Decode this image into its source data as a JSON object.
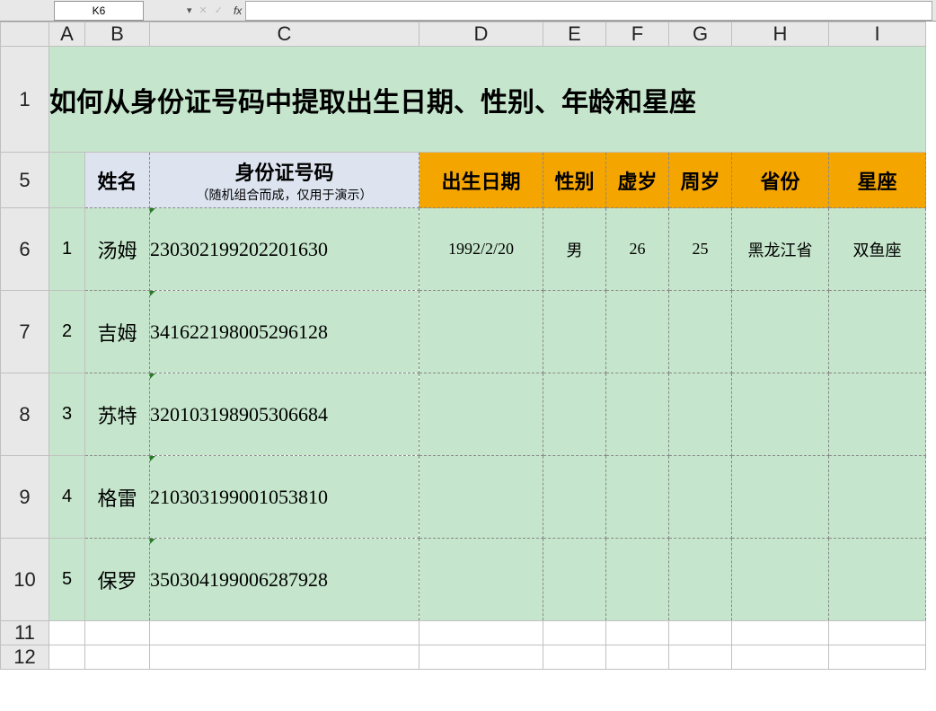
{
  "formula_bar": {
    "name_box": "K6",
    "fx_label": "fx"
  },
  "columns": [
    "A",
    "B",
    "C",
    "D",
    "E",
    "F",
    "G",
    "H",
    "I"
  ],
  "row_labels": [
    "1",
    "5",
    "6",
    "7",
    "8",
    "9",
    "10",
    "11",
    "12"
  ],
  "title": "如何从身份证号码中提取出生日期、性别、年龄和星座",
  "headers": {
    "name": "姓名",
    "id": "身份证号码",
    "id_sub": "（随机组合而成，仅用于演示）",
    "birth": "出生日期",
    "gender": "性别",
    "age_nominal": "虚岁",
    "age_full": "周岁",
    "province": "省份",
    "zodiac": "星座"
  },
  "rows": [
    {
      "idx": "1",
      "name": "汤姆",
      "id": "230302199202201630",
      "birth": "1992/2/20",
      "gender": "男",
      "age_nominal": "26",
      "age_full": "25",
      "province": "黑龙江省",
      "zodiac": "双鱼座"
    },
    {
      "idx": "2",
      "name": "吉姆",
      "id": "341622198005296128",
      "birth": "",
      "gender": "",
      "age_nominal": "",
      "age_full": "",
      "province": "",
      "zodiac": ""
    },
    {
      "idx": "3",
      "name": "苏特",
      "id": "320103198905306684",
      "birth": "",
      "gender": "",
      "age_nominal": "",
      "age_full": "",
      "province": "",
      "zodiac": ""
    },
    {
      "idx": "4",
      "name": "格雷",
      "id": "210303199001053810",
      "birth": "",
      "gender": "",
      "age_nominal": "",
      "age_full": "",
      "province": "",
      "zodiac": ""
    },
    {
      "idx": "5",
      "name": "保罗",
      "id": "350304199006287928",
      "birth": "",
      "gender": "",
      "age_nominal": "",
      "age_full": "",
      "province": "",
      "zodiac": ""
    }
  ]
}
